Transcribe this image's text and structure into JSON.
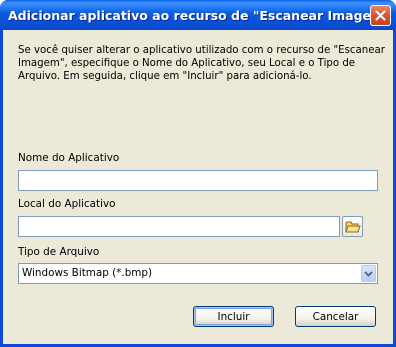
{
  "dialog": {
    "title": "Adicionar aplicativo ao recurso de  \"Escanear Imagem\"",
    "description": "Se você quiser alterar o aplicativo utilizado com o recurso de \"Escanear Imagem\", especifique o Nome do Aplicativo, seu Local e o Tipo de Arquivo. Em seguida, clique em \"Incluir\" para adicioná-lo."
  },
  "fields": {
    "app_name_label": "Nome do Aplicativo",
    "app_name_value": "",
    "app_location_label": "Local do Aplicativo",
    "app_location_value": "",
    "file_type_label": "Tipo de Arquivo",
    "file_type_value": "Windows Bitmap (*.bmp)"
  },
  "buttons": {
    "include": "Incluir",
    "cancel": "Cancelar"
  },
  "icons": {
    "close": "close-icon",
    "browse": "folder-icon",
    "dropdown": "chevron-down-icon"
  },
  "colors": {
    "titlebar": "#0a50d8",
    "client_bg": "#ece9d8",
    "close_button": "#d9532f",
    "input_border": "#7f9db9"
  }
}
